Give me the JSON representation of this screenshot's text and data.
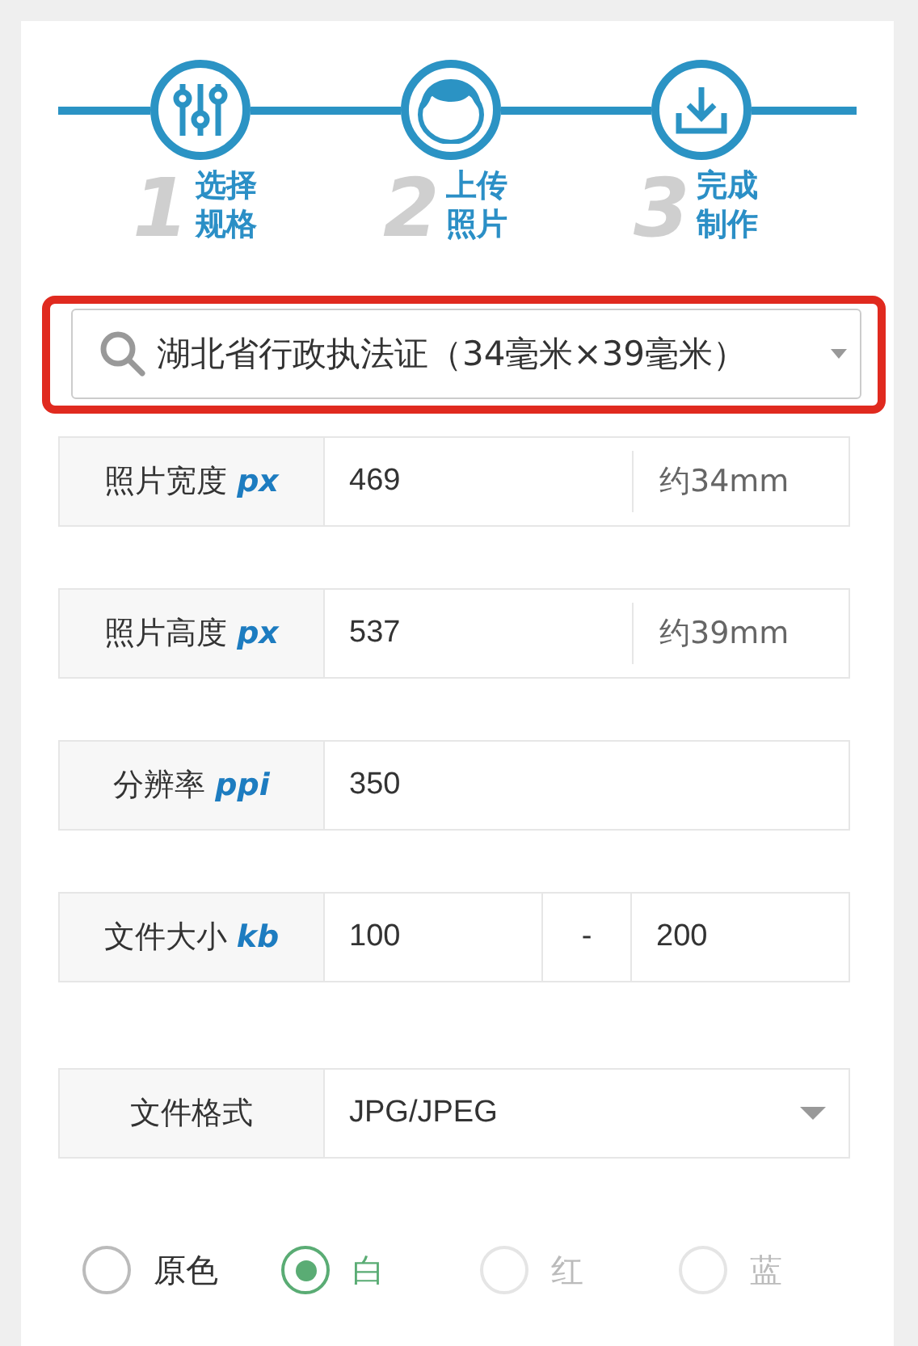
{
  "steps": [
    {
      "kind": "sliders",
      "number": "1",
      "label_lines": [
        "选择",
        "规格"
      ]
    },
    {
      "kind": "person",
      "number": "2",
      "label_lines": [
        "上传",
        "照片"
      ]
    },
    {
      "kind": "download",
      "number": "3",
      "label_lines": [
        "完成",
        "制作"
      ]
    }
  ],
  "spec_select": {
    "value": "湖北省行政执法证（34毫米×39毫米）",
    "highlighted": true
  },
  "fields": [
    {
      "kind": "single",
      "label": "照片宽度",
      "unit": "px",
      "value": "469",
      "note": "约34mm"
    },
    {
      "kind": "single",
      "label": "照片高度",
      "unit": "px",
      "value": "537",
      "note": "约39mm"
    },
    {
      "kind": "single",
      "label": "分辨率",
      "unit": "ppi",
      "value": "350"
    },
    {
      "kind": "range",
      "label": "文件大小",
      "unit": "kb",
      "min": "100",
      "separator": "-",
      "max": "200"
    },
    {
      "kind": "select",
      "label": "文件格式",
      "value": "JPG/JPEG"
    }
  ],
  "background_options": [
    {
      "label": "原色",
      "selected": false,
      "disabled": false
    },
    {
      "label": "白",
      "selected": true,
      "disabled": false
    },
    {
      "label": "红",
      "selected": false,
      "disabled": true
    },
    {
      "label": "蓝",
      "selected": false,
      "disabled": true
    }
  ]
}
